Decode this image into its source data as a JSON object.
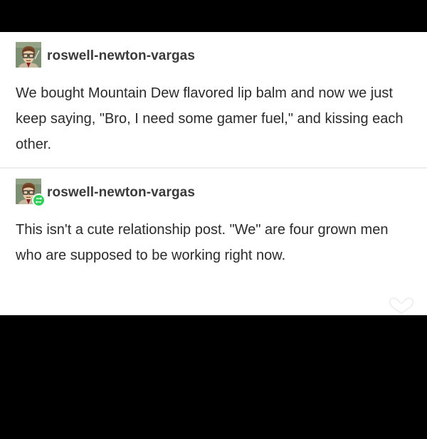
{
  "posts": [
    {
      "username": "roswell-newton-vargas",
      "text": "We bought Mountain Dew flavored lip balm and now we just keep saying, \"Bro, I need some gamer fuel,\" and kissing each other."
    },
    {
      "username": "roswell-newton-vargas",
      "text": "This isn't a cute relationship post. \"We\" are four grown men who are supposed to be working right now."
    }
  ],
  "colors": {
    "card_background": "#ffffff",
    "page_background": "#000000",
    "reblog_badge": "#2fd05a"
  },
  "icons": {
    "avatar": "cartoon-man-with-glasses-avatar",
    "reblog": "reblog-icon",
    "watermark": "heart-logo-icon"
  }
}
